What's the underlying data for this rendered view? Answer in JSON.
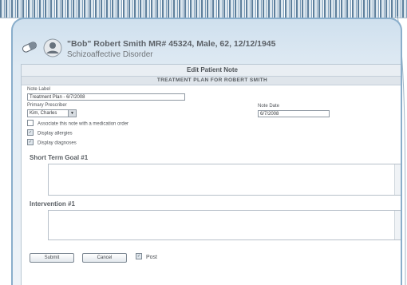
{
  "header": {
    "patient_name": "\"Bob\" Robert Smith  MR# 45324, Male, 62, 12/12/1945",
    "diagnosis": "Schizoaffective Disorder"
  },
  "form": {
    "title": "Edit Patient Note",
    "plan_title": "TREATMENT PLAN FOR ROBERT SMITH",
    "note_label_label": "Note Label",
    "note_label_value": "Treatment Plan - 6/7/2008",
    "primary_prescriber_label": "Primary Prescriber",
    "primary_prescriber_value": "Kim, Charles",
    "note_date_label": "Note Date",
    "note_date_value": "6/7/2008",
    "checkboxes": [
      {
        "label": "Associate this note with a medication order",
        "checked": false
      },
      {
        "label": "Display allergies",
        "checked": true
      },
      {
        "label": "Display diagnoses",
        "checked": true
      }
    ],
    "short_term_goal_heading": "Short Term Goal #1",
    "intervention_heading": "Intervention #1",
    "submit_label": "Submit",
    "cancel_label": "Cancel",
    "post_label": "Post",
    "post_checked": true
  },
  "colors": {
    "panel_border": "#8aaecb",
    "panel_bg": "#dfeaf3",
    "spiral": "#5d7f9c"
  },
  "icons": [
    "pill-icon",
    "patient-icon",
    "chevron-down-icon",
    "check-icon"
  ]
}
